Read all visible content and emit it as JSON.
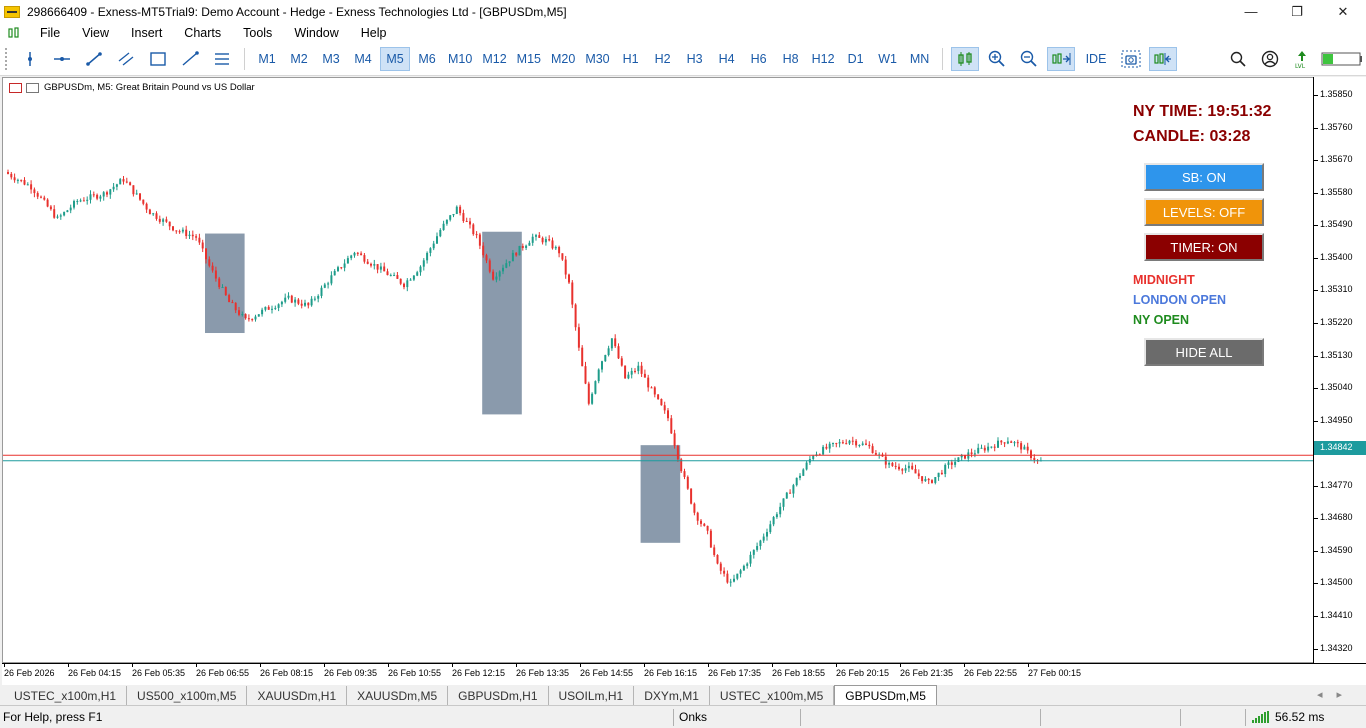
{
  "window": {
    "title": "298666409 - Exness-MT5Trial9: Demo Account - Hedge - Exness Technologies Ltd - [GBPUSDm,M5]",
    "controls": [
      "—",
      "❐",
      "✕"
    ]
  },
  "menu": [
    "File",
    "View",
    "Insert",
    "Charts",
    "Tools",
    "Window",
    "Help"
  ],
  "toolbar": {
    "timeframes": [
      "M1",
      "M2",
      "M3",
      "M4",
      "M5",
      "M6",
      "M10",
      "M12",
      "M15",
      "M20",
      "M30",
      "H1",
      "H2",
      "H3",
      "H4",
      "H6",
      "H8",
      "H12",
      "D1",
      "W1",
      "MN"
    ],
    "active_timeframe": "M5",
    "ide_label": "IDE"
  },
  "chart": {
    "header": "GBPUSDm, M5:  Great Britain Pound vs US Dollar",
    "current_price": "1.34842",
    "price_labels": [
      "1.35850",
      "1.35760",
      "1.35670",
      "1.35580",
      "1.35490",
      "1.35400",
      "1.35310",
      "1.35220",
      "1.35130",
      "1.35040",
      "1.34950",
      "1.34770",
      "1.34680",
      "1.34590",
      "1.34500",
      "1.34410",
      "1.34320"
    ],
    "time_labels": [
      "26 Feb 2026",
      "26 Feb 04:15",
      "26 Feb 05:35",
      "26 Feb 06:55",
      "26 Feb 08:15",
      "26 Feb 09:35",
      "26 Feb 10:55",
      "26 Feb 12:15",
      "26 Feb 13:35",
      "26 Feb 14:55",
      "26 Feb 16:15",
      "26 Feb 17:35",
      "26 Feb 18:55",
      "26 Feb 20:15",
      "26 Feb 21:35",
      "26 Feb 22:55",
      "27 Feb 00:15"
    ]
  },
  "chart_data": {
    "type": "candlestick",
    "symbol": "GBPUSDm",
    "timeframe": "M5",
    "ylim": [
      1.3428,
      1.359
    ],
    "x_first": "26 Feb 2026",
    "x_last": "27 Feb 00:15",
    "bid_line": 1.34842,
    "ask_line": 1.34857,
    "close_path": [
      {
        "t": 0,
        "p": 1.3564
      },
      {
        "t": 8,
        "p": 1.356
      },
      {
        "t": 16,
        "p": 1.3551
      },
      {
        "t": 22,
        "p": 1.3556
      },
      {
        "t": 30,
        "p": 1.3558
      },
      {
        "t": 36,
        "p": 1.3562
      },
      {
        "t": 44,
        "p": 1.3553
      },
      {
        "t": 52,
        "p": 1.3548
      },
      {
        "t": 58,
        "p": 1.3546
      },
      {
        "t": 62,
        "p": 1.3538
      },
      {
        "t": 68,
        "p": 1.3528
      },
      {
        "t": 73,
        "p": 1.3523
      },
      {
        "t": 79,
        "p": 1.3526
      },
      {
        "t": 86,
        "p": 1.3529
      },
      {
        "t": 92,
        "p": 1.3527
      },
      {
        "t": 99,
        "p": 1.3535
      },
      {
        "t": 106,
        "p": 1.3542
      },
      {
        "t": 114,
        "p": 1.3537
      },
      {
        "t": 121,
        "p": 1.3533
      },
      {
        "t": 126,
        "p": 1.3538
      },
      {
        "t": 132,
        "p": 1.3548
      },
      {
        "t": 137,
        "p": 1.3554
      },
      {
        "t": 143,
        "p": 1.3546
      },
      {
        "t": 148,
        "p": 1.3535
      },
      {
        "t": 154,
        "p": 1.3541
      },
      {
        "t": 160,
        "p": 1.3546
      },
      {
        "t": 164,
        "p": 1.3545
      },
      {
        "t": 168,
        "p": 1.3542
      },
      {
        "t": 171,
        "p": 1.3533
      },
      {
        "t": 174,
        "p": 1.3515
      },
      {
        "t": 177,
        "p": 1.35
      },
      {
        "t": 180,
        "p": 1.351
      },
      {
        "t": 184,
        "p": 1.3518
      },
      {
        "t": 188,
        "p": 1.3507
      },
      {
        "t": 192,
        "p": 1.351
      },
      {
        "t": 197,
        "p": 1.3502
      },
      {
        "t": 201,
        "p": 1.3496
      },
      {
        "t": 205,
        "p": 1.3482
      },
      {
        "t": 209,
        "p": 1.347
      },
      {
        "t": 213,
        "p": 1.3464
      },
      {
        "t": 216,
        "p": 1.3455
      },
      {
        "t": 220,
        "p": 1.345
      },
      {
        "t": 224,
        "p": 1.3455
      },
      {
        "t": 229,
        "p": 1.3462
      },
      {
        "t": 234,
        "p": 1.347
      },
      {
        "t": 240,
        "p": 1.3479
      },
      {
        "t": 245,
        "p": 1.3486
      },
      {
        "t": 250,
        "p": 1.3488
      },
      {
        "t": 256,
        "p": 1.349
      },
      {
        "t": 262,
        "p": 1.3488
      },
      {
        "t": 268,
        "p": 1.3483
      },
      {
        "t": 274,
        "p": 1.3482
      },
      {
        "t": 280,
        "p": 1.3478
      },
      {
        "t": 286,
        "p": 1.3483
      },
      {
        "t": 292,
        "p": 1.3486
      },
      {
        "t": 298,
        "p": 1.3488
      },
      {
        "t": 304,
        "p": 1.349
      },
      {
        "t": 308,
        "p": 1.3488
      },
      {
        "t": 313,
        "p": 1.3484
      }
    ],
    "highlight_boxes": [
      {
        "t0": 60,
        "t1": 72,
        "p_high": 1.3547,
        "p_low": 1.35195
      },
      {
        "t0": 144,
        "t1": 156,
        "p_high": 1.35475,
        "p_low": 1.3497
      },
      {
        "t0": 192,
        "t1": 204,
        "p_high": 1.34885,
        "p_low": 1.34615
      }
    ]
  },
  "panel": {
    "ny_time": "NY TIME: 19:51:32",
    "candle": "CANDLE: 03:28",
    "sb_button": "SB: ON",
    "levels_button": "LEVELS: OFF",
    "timer_button": "TIMER: ON",
    "session_midnight": "MIDNIGHT",
    "session_london": "LONDON OPEN",
    "session_ny": "NY OPEN",
    "hide_all": "HIDE ALL",
    "colors": {
      "sb": "#2e95ec",
      "levels": "#f0940a",
      "timer": "#8b0000",
      "hide": "#6b6b6b",
      "midnight": "#e8312d",
      "london": "#4b78db",
      "ny": "#1e8b1e"
    }
  },
  "tabs": [
    "USTEC_x100m,H1",
    "US500_x100m,M5",
    "XAUUSDm,H1",
    "XAUUSDm,M5",
    "GBPUSDm,H1",
    "USOILm,H1",
    "DXYm,M1",
    "USTEC_x100m,M5",
    "GBPUSDm,M5"
  ],
  "active_tab": "GBPUSDm,M5",
  "status": {
    "help": "For Help, press F1",
    "profile": "Onks",
    "ping": "56.52 ms"
  }
}
